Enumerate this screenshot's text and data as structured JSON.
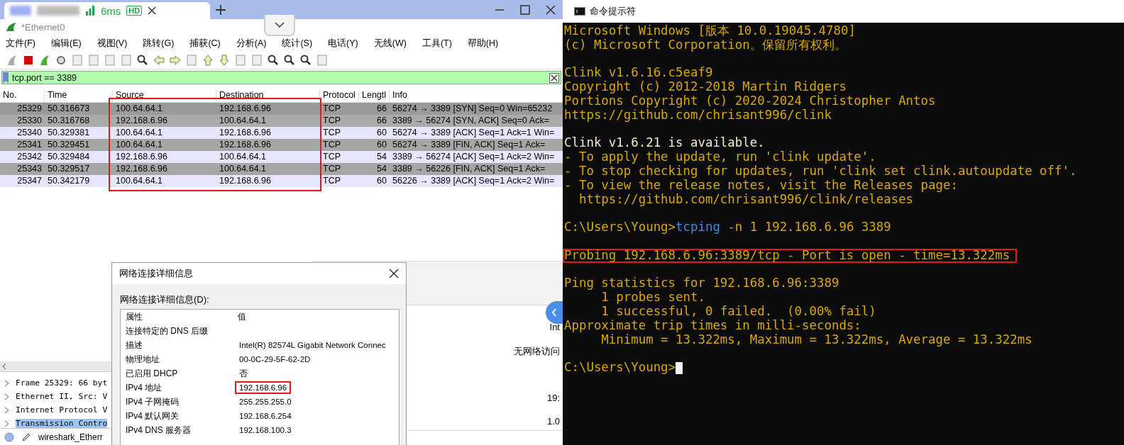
{
  "browser_tab": {
    "latency": "6ms",
    "quality_badge": "HD"
  },
  "wireshark": {
    "title": "*Ethernet0",
    "menu": [
      "文件(F)",
      "编辑(E)",
      "视图(V)",
      "跳转(G)",
      "捕获(C)",
      "分析(A)",
      "统计(S)",
      "电话(Y)",
      "无线(W)",
      "工具(T)",
      "帮助(H)"
    ],
    "filter": {
      "value": "tcp.port == 3389"
    },
    "packet_list": {
      "columns": [
        {
          "label": "No.",
          "highlighted": false
        },
        {
          "label": "Time",
          "highlighted": false
        },
        {
          "label": "Source",
          "highlighted": true
        },
        {
          "label": "Destination",
          "highlighted": true
        },
        {
          "label": "Protocol",
          "highlighted": false
        },
        {
          "label": "Lengtl",
          "highlighted": false
        },
        {
          "label": "Info",
          "highlighted": false
        }
      ],
      "rows": [
        {
          "cells": [
            "25329",
            "50.316673",
            "100.64.64.1",
            "192.168.6.96",
            "TCP",
            "66",
            "56274 → 3389 [SYN] Seq=0 Win=65232"
          ],
          "color": "#9a9a9a"
        },
        {
          "cells": [
            "25330",
            "50.316768",
            "192.168.6.96",
            "100.64.64.1",
            "TCP",
            "66",
            "3389 → 56274 [SYN, ACK] Seq=0 Ack="
          ],
          "color": "#ababab"
        },
        {
          "cells": [
            "25340",
            "50.329381",
            "100.64.64.1",
            "192.168.6.96",
            "TCP",
            "60",
            "56274 → 3389 [ACK] Seq=1 Ack=1 Win="
          ],
          "color": "#e7e6ff"
        },
        {
          "cells": [
            "25341",
            "50.329451",
            "100.64.64.1",
            "192.168.6.96",
            "TCP",
            "60",
            "56274 → 3389 [FIN, ACK] Seq=1 Ack="
          ],
          "color": "#a6a6a6"
        },
        {
          "cells": [
            "25342",
            "50.329484",
            "192.168.6.96",
            "100.64.64.1",
            "TCP",
            "54",
            "3389 → 56274 [ACK] Seq=1 Ack=2 Win="
          ],
          "color": "#e7e6ff"
        },
        {
          "cells": [
            "25343",
            "50.329517",
            "192.168.6.96",
            "100.64.64.1",
            "TCP",
            "54",
            "3389 → 56226 [FIN, ACK] Seq=1 Ack="
          ],
          "color": "#a6a6a6"
        },
        {
          "cells": [
            "25347",
            "50.342179",
            "100.64.64.1",
            "192.168.6.96",
            "TCP",
            "60",
            "56226 → 3389 [ACK] Seq=1 Ack=2 Win="
          ],
          "color": "#e7e6ff"
        }
      ]
    },
    "details": [
      {
        "label": "Frame 25329: 66 byt",
        "selected": false
      },
      {
        "label": "Ethernet II, Src: V",
        "selected": false
      },
      {
        "label": "Internet Protocol V",
        "selected": false
      },
      {
        "label": "Transmission Contro",
        "selected": true
      }
    ],
    "status_bar": {
      "file": "wireshark_Etherr"
    }
  },
  "settings_panel": {
    "texts": [
      "Int",
      "无网络访问",
      "19:",
      "1.0"
    ]
  },
  "details_dialog": {
    "title": "网络连接详细信息",
    "list_label": "网络连接详细信息(D):",
    "columns": [
      "属性",
      "值"
    ],
    "rows": [
      {
        "property": "连接特定的 DNS 后缀"
      },
      {
        "property": "描述",
        "value": "Intel(R) 82574L Gigabit Network Connec",
        "highlighted": false
      },
      {
        "property": "物理地址",
        "value": "00-0C-29-5F-62-2D",
        "highlighted": false
      },
      {
        "property": "已启用 DHCP",
        "value": "否",
        "highlighted": false
      },
      {
        "property": "IPv4 地址",
        "value": "192.168.6.96",
        "highlighted": true
      },
      {
        "property": "IPv4 子网掩码",
        "value": "255.255.255.0",
        "highlighted": false
      },
      {
        "property": "IPv4 默认网关",
        "value": "192.168.6.254",
        "highlighted": false
      },
      {
        "property": "IPv4 DNS 服务器",
        "value": "192.168.100.3",
        "highlighted": false
      }
    ]
  },
  "console": {
    "title": "命令提示符",
    "lines": [
      {
        "kind": "text",
        "segments": [
          {
            "text": "Microsoft Windows [版本 10.0.19045.4780]",
            "color": "#d9a800"
          }
        ],
        "highlighted": false
      },
      {
        "kind": "text",
        "segments": [
          {
            "text": "(c) Microsoft Corporation。保留所有权利。",
            "color": "#d9a800"
          }
        ],
        "highlighted": false
      },
      {
        "kind": "blank"
      },
      {
        "kind": "text",
        "segments": [
          {
            "text": "Clink v1.6.16.c5eaf9",
            "color": "#d9a800"
          }
        ],
        "highlighted": false
      },
      {
        "kind": "text",
        "segments": [
          {
            "text": "Copyright (c) 2012-2018 Martin Ridgers",
            "color": "#d9a800"
          }
        ],
        "highlighted": false
      },
      {
        "kind": "text",
        "segments": [
          {
            "text": "Portions Copyright (c) 2020-2024 Christopher Antos",
            "color": "#d9a800"
          }
        ],
        "highlighted": false
      },
      {
        "kind": "text",
        "segments": [
          {
            "text": "https://github.com/chrisant996/clink",
            "color": "#d9a800"
          }
        ],
        "highlighted": false
      },
      {
        "kind": "blank"
      },
      {
        "kind": "text",
        "segments": [
          {
            "text": "Clink v1.6.21 is available.",
            "color": "#f2eccf"
          }
        ],
        "highlighted": false
      },
      {
        "kind": "text",
        "segments": [
          {
            "text": "- To apply the update, run 'clink update'.",
            "color": "#d9a800"
          }
        ],
        "highlighted": false
      },
      {
        "kind": "text",
        "segments": [
          {
            "text": "- To stop checking for updates, run 'clink set clink.autoupdate off'.",
            "color": "#d9a800"
          }
        ],
        "highlighted": false
      },
      {
        "kind": "text",
        "segments": [
          {
            "text": "- To view the release notes, visit the Releases page:",
            "color": "#d9a800"
          }
        ],
        "highlighted": false
      },
      {
        "kind": "text",
        "segments": [
          {
            "text": "  https://github.com/chrisant996/clink/releases",
            "color": "#d9a800"
          }
        ],
        "highlighted": false
      },
      {
        "kind": "blank"
      },
      {
        "kind": "text",
        "segments": [
          {
            "text": "C:\\Users\\Young>",
            "color": "#d9a800"
          },
          {
            "text": "tcping",
            "color": "#3b8eea"
          },
          {
            "text": " -n 1 192.168.6.96 3389",
            "color": "#d9a800"
          }
        ],
        "highlighted": false
      },
      {
        "kind": "blank"
      },
      {
        "kind": "text",
        "segments": [
          {
            "text": "Probing 192.168.6.96:3389/tcp - Port is open - time=13.322ms",
            "color": "#d9a800"
          }
        ],
        "highlighted": true
      },
      {
        "kind": "blank"
      },
      {
        "kind": "text",
        "segments": [
          {
            "text": "Ping statistics for 192.168.6.96:3389",
            "color": "#d9a800"
          }
        ],
        "highlighted": false
      },
      {
        "kind": "text",
        "segments": [
          {
            "text": "     1 probes sent.",
            "color": "#d9a800"
          }
        ],
        "highlighted": false
      },
      {
        "kind": "text",
        "segments": [
          {
            "text": "     1 successful, 0 failed.  (0.00% fail)",
            "color": "#d9a800"
          }
        ],
        "highlighted": false
      },
      {
        "kind": "text",
        "segments": [
          {
            "text": "Approximate trip times in milli-seconds:",
            "color": "#d9a800"
          }
        ],
        "highlighted": false
      },
      {
        "kind": "text",
        "segments": [
          {
            "text": "     Minimum = 13.322ms, Maximum = 13.322ms, Average = 13.322ms",
            "color": "#d9a800"
          }
        ],
        "highlighted": false
      },
      {
        "kind": "blank"
      },
      {
        "kind": "text",
        "segments": [
          {
            "text": "C:\\Users\\Young>",
            "color": "#d9a800"
          }
        ],
        "highlighted": false,
        "cursor": true
      }
    ]
  }
}
